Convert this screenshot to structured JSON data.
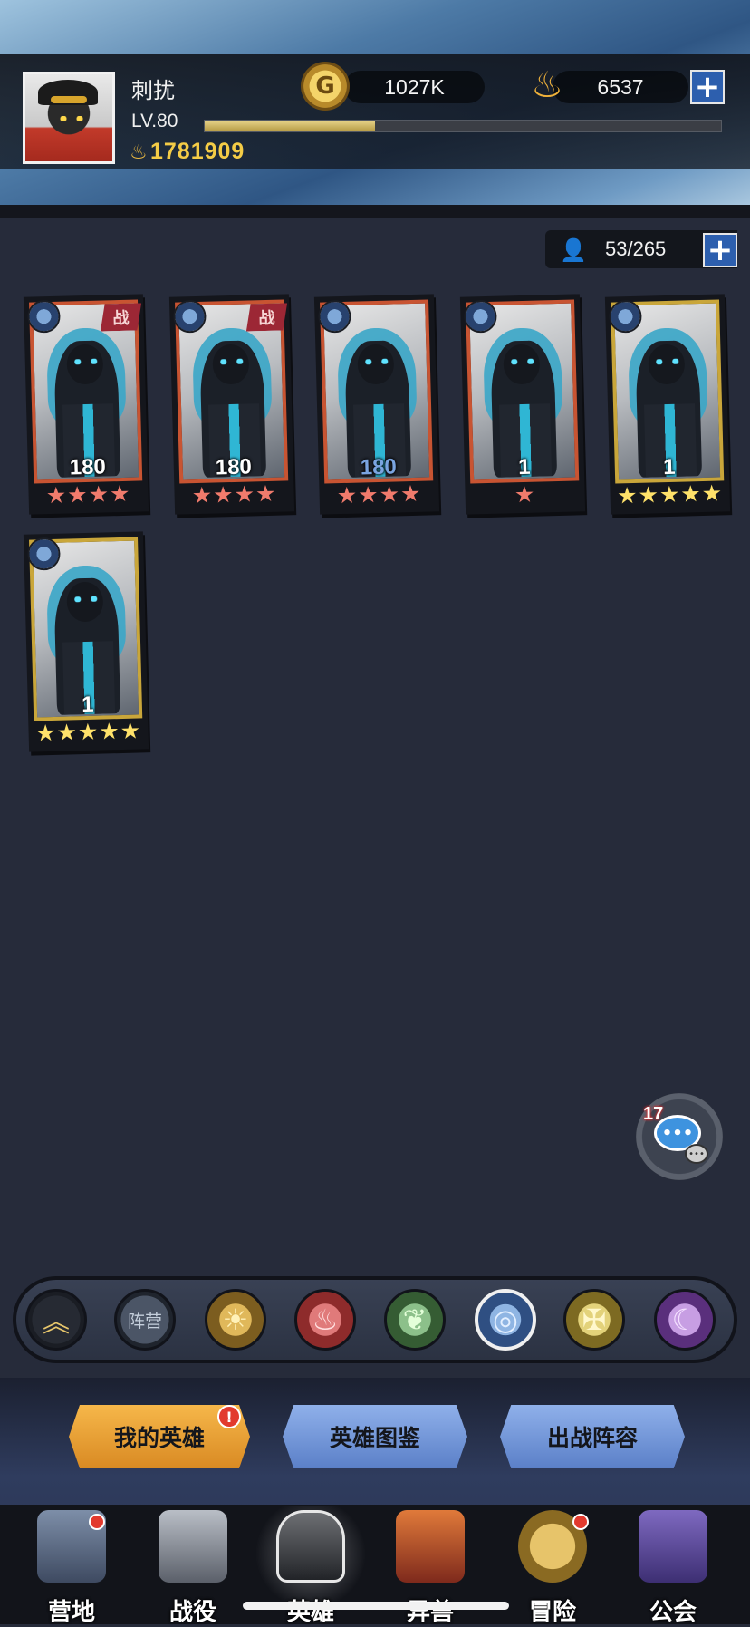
{
  "player": {
    "name": "刺扰",
    "level": "LV.80",
    "xp_fraction": 0.33,
    "power": "1781909"
  },
  "resources": {
    "gold": "1027K",
    "gold_icon_glyph": "G",
    "gems": "6537",
    "gem_icon_glyph": "♨",
    "plus_glyph": "+"
  },
  "hero_count": {
    "text": "53/265",
    "user_icon_glyph": "👤"
  },
  "heroes": [
    {
      "level": "180",
      "stars": "★★★★",
      "star_color": "red",
      "frame": "red",
      "in_battle": true,
      "battle_tag": "战"
    },
    {
      "level": "180",
      "stars": "★★★★",
      "star_color": "red",
      "frame": "red",
      "in_battle": true,
      "battle_tag": "战"
    },
    {
      "level": "180",
      "stars": "★★★★",
      "star_color": "red",
      "frame": "red",
      "in_battle": false,
      "level_color": "blue"
    },
    {
      "level": "1",
      "stars": "★",
      "star_color": "red",
      "frame": "red",
      "in_battle": false
    },
    {
      "level": "1",
      "stars": "★★★★★",
      "star_color": "yellow",
      "frame": "gold",
      "in_battle": false
    },
    {
      "level": "1",
      "stars": "★★★★★",
      "star_color": "yellow",
      "frame": "gold",
      "in_battle": false
    }
  ],
  "chat": {
    "unread_count": "17",
    "bubble_glyph": "•••",
    "mini_glyph": "•••"
  },
  "filters": {
    "all_glyph": "︽",
    "camp_label": "阵营",
    "light_glyph": "☀",
    "fire_glyph": "♨",
    "nature_glyph": "❦",
    "water_glyph": "◎",
    "holy_glyph": "✠",
    "dark_glyph": "☾",
    "selected": "water"
  },
  "tabs": {
    "my_heroes": "我的英雄",
    "my_heroes_alert": "!",
    "codex": "英雄图鉴",
    "lineup": "出战阵容"
  },
  "nav": {
    "camp": "营地",
    "campaign": "战役",
    "heroes": "英雄",
    "beasts": "异兽",
    "adventure": "冒险",
    "guild": "公会",
    "active": "heroes"
  },
  "colors": {
    "background": "#262b3a",
    "gold_text": "#f4cc46",
    "red_star": "#f17b6c",
    "yellow_star": "#ffe26a",
    "tab_orange": "#f6b74a",
    "tab_blue": "#8fb0ea",
    "alert_red": "#e23a2e"
  }
}
